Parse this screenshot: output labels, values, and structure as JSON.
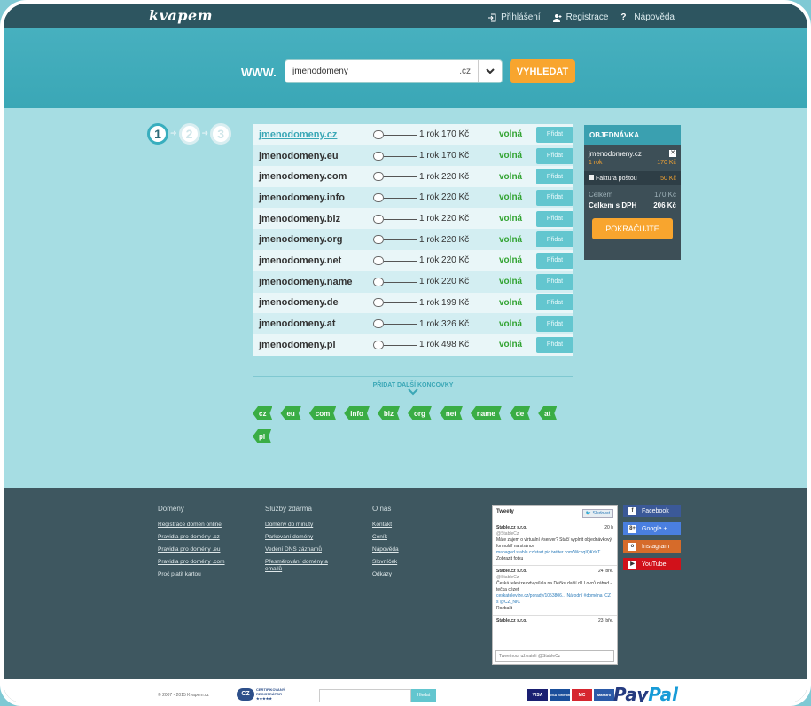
{
  "header": {
    "logo": "kvapem",
    "nav": [
      {
        "label": "Přihlášení",
        "icon": "login-icon"
      },
      {
        "label": "Registrace",
        "icon": "add-user-icon"
      },
      {
        "label": "Nápověda",
        "icon": "help-icon"
      }
    ]
  },
  "search": {
    "prefix": "WWW.",
    "value": "jmenodomeny",
    "tld": ".cz",
    "button": "VYHLEDAT"
  },
  "steps": [
    "1",
    "2",
    "3"
  ],
  "domains": [
    {
      "name": "jmenodomeny.cz",
      "price": "1 rok 170 Kč",
      "status": "volná",
      "action": "Přidat"
    },
    {
      "name": "jmenodomeny.eu",
      "price": "1 rok 170 Kč",
      "status": "volná",
      "action": "Přidat"
    },
    {
      "name": "jmenodomeny.com",
      "price": "1 rok 220 Kč",
      "status": "volná",
      "action": "Přidat"
    },
    {
      "name": "jmenodomeny.info",
      "price": "1 rok 220 Kč",
      "status": "volná",
      "action": "Přidat"
    },
    {
      "name": "jmenodomeny.biz",
      "price": "1 rok 220 Kč",
      "status": "volná",
      "action": "Přidat"
    },
    {
      "name": "jmenodomeny.org",
      "price": "1 rok 220 Kč",
      "status": "volná",
      "action": "Přidat"
    },
    {
      "name": "jmenodomeny.net",
      "price": "1 rok 220 Kč",
      "status": "volná",
      "action": "Přidat"
    },
    {
      "name": "jmenodomeny.name",
      "price": "1 rok 220 Kč",
      "status": "volná",
      "action": "Přidat"
    },
    {
      "name": "jmenodomeny.de",
      "price": "1 rok 199 Kč",
      "status": "volná",
      "action": "Přidat"
    },
    {
      "name": "jmenodomeny.at",
      "price": "1 rok 326 Kč",
      "status": "volná",
      "action": "Přidat"
    },
    {
      "name": "jmenodomeny.pl",
      "price": "1 rok 498 Kč",
      "status": "volná",
      "action": "Přidat"
    }
  ],
  "order": {
    "title": "OBJEDNÁVKA",
    "item_name": "jmenodomeny.cz",
    "item_period": "1 rok",
    "item_price": "170 Kč",
    "invoice_label": "Faktura poštou",
    "invoice_price": "50 Kč",
    "total_label": "Celkem",
    "total_value": "170 Kč",
    "total_vat_label": "Celkem s DPH",
    "total_vat_value": "206 Kč",
    "continue": "POKRAČUJTE"
  },
  "more_label": "PŘIDAT DALŠÍ KONCOVKY",
  "tags": [
    "cz",
    "eu",
    "com",
    "info",
    "biz",
    "org",
    "net",
    "name",
    "de",
    "at",
    "pl"
  ],
  "footer": {
    "columns": [
      {
        "title": "Domény",
        "links": [
          "Registrace domén online",
          "Pravidla pro domény .cz",
          "Pravidla pro domény .eu",
          "Pravidla pro domény .com",
          "Proč platit kartou"
        ]
      },
      {
        "title": "Služby zdarma",
        "links": [
          "Domény do minuty",
          "Parkování domény",
          "Vedení DNS záznamů",
          "Přesměrování domény a emailů"
        ]
      },
      {
        "title": "O nás",
        "links": [
          "Kontakt",
          "Ceník",
          "Nápověda",
          "Slovníček",
          "Odkazy"
        ]
      }
    ],
    "twitter": {
      "title": "Tweety",
      "follow": "Sledovat",
      "tweets": [
        {
          "user": "Stable.cz s.r.o.",
          "handle": "@StableCz",
          "time": "20 h",
          "text": "Máte zájem o virtuální #server? Stačí vyplnit objednávkový formulář na stránce",
          "link": "managed.stable.cz/start pic.twitter.com/WcnqIQKdcT",
          "extra": "Zobrazit fotku"
        },
        {
          "user": "Stable.cz s.r.o.",
          "handle": "@StableCz",
          "time": "24. bře.",
          "text": "Česká televize odvysílala na Déčku další díl Lovců záhad - tečka cézet",
          "link": "ceskatelevize.cz/porady/1053806... Národní #doména .CZ s @CZ_NIC",
          "extra": "Rozbalit"
        },
        {
          "user": "Stable.cz s.r.o.",
          "handle": "",
          "time": "23. bře.",
          "text": "",
          "link": "",
          "extra": ""
        }
      ],
      "input_placeholder": "Tweetnout uživateli @StableCz"
    },
    "social": [
      {
        "label": "Facebook",
        "color": "#3b5998",
        "icon": "f"
      },
      {
        "label": "Google +",
        "color": "#4a7fe0",
        "icon": "8+"
      },
      {
        "label": "Instagram",
        "color": "#d66b2a",
        "icon": "o"
      },
      {
        "label": "YouTube",
        "color": "#d1111a",
        "icon": "▶"
      }
    ]
  },
  "bottom": {
    "copyright": "© 2007 - 2015 Kvapem.cz",
    "cz_badge_logo": "CZ",
    "cz_badge_line1": "CERTIFIKOVANÝ",
    "cz_badge_line2": "REGISTRÁTOR",
    "cz_badge_stars": "★★★★★",
    "search_button": "Hledat",
    "cards": [
      {
        "label": "VISA",
        "color": "#1a1f71"
      },
      {
        "label": "VISA Electron",
        "color": "#1a4f9b"
      },
      {
        "label": "MC",
        "color": "#d6262f"
      },
      {
        "label": "Maestro",
        "color": "#2b5aa8"
      }
    ],
    "paypal_1": "Pay",
    "paypal_2": "Pal"
  }
}
